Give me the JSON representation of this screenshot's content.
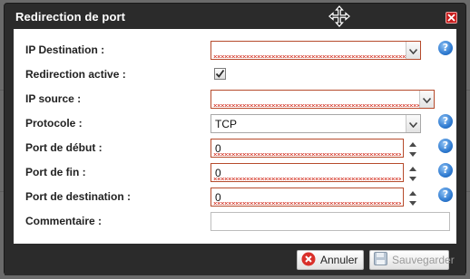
{
  "dialog": {
    "title": "Redirection de port",
    "close_icon": "close-icon",
    "move_icon": "move-cursor-icon"
  },
  "form": {
    "ip_destination": {
      "label": "IP Destination :",
      "value": "",
      "invalid": true
    },
    "redirection_active": {
      "label": "Redirection active :",
      "checked": true
    },
    "ip_source": {
      "label": "IP source :",
      "value": "",
      "invalid": true
    },
    "protocole": {
      "label": "Protocole :",
      "value": "TCP"
    },
    "port_debut": {
      "label": "Port de début :",
      "value": "0",
      "invalid": true
    },
    "port_fin": {
      "label": "Port de fin :",
      "value": "0",
      "invalid": true
    },
    "port_destination": {
      "label": "Port de destination :",
      "value": "0",
      "invalid": true
    },
    "commentaire": {
      "label": "Commentaire :",
      "value": ""
    }
  },
  "help_icon": "?",
  "footer": {
    "cancel_label": "Annuler",
    "save_label": "Sauvegarder",
    "save_enabled": false
  },
  "colors": {
    "dialog_bg": "#2b2b2b",
    "error_border": "#b64b2c",
    "help_blue": "#2f7bd1",
    "close_red": "#c81e1e"
  }
}
